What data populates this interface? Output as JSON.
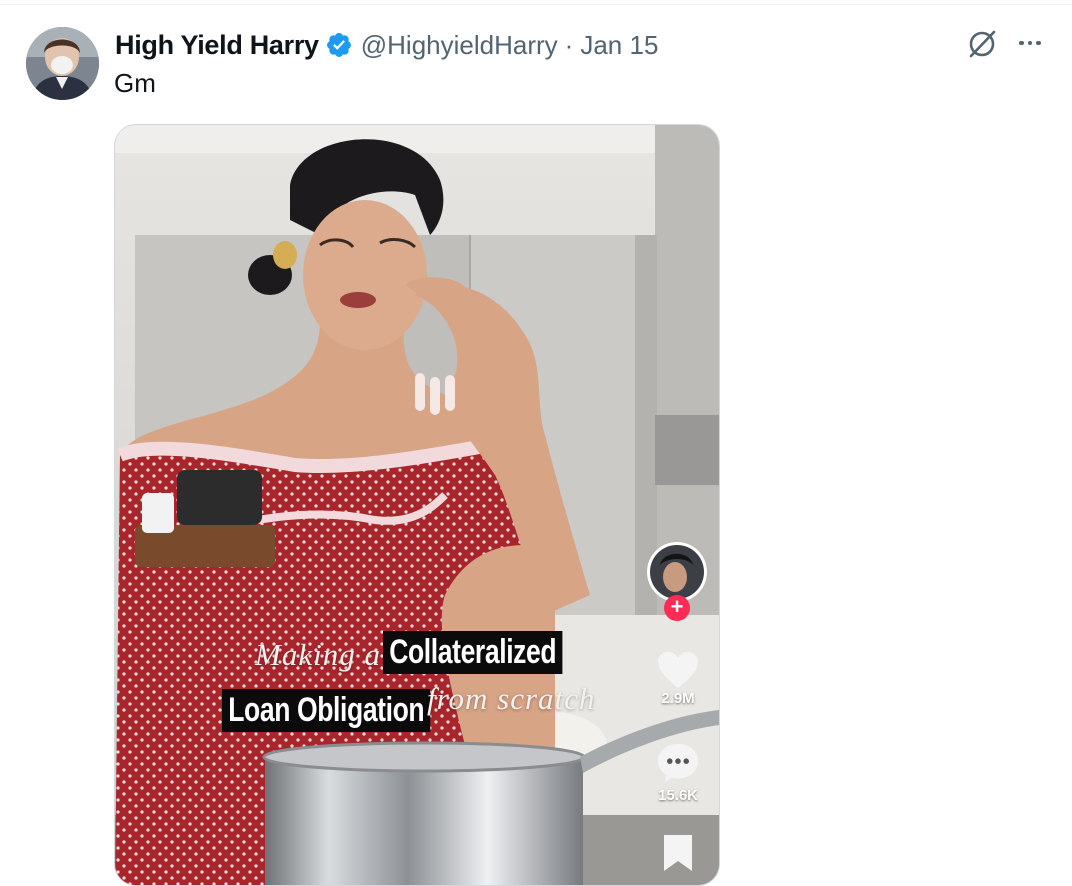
{
  "tweet": {
    "author_name": "High Yield Harry",
    "author_handle": "@HighyieldHarry",
    "separator": "·",
    "date": "Jan 15",
    "text": "Gm"
  },
  "video": {
    "caption_italic_1": "Making a",
    "caption_bold_1": "Collateralized",
    "caption_bold_2": "Loan Obligation",
    "caption_italic_2": "from scratch",
    "likes_count": "2.9M",
    "comments_count": "15.6K"
  },
  "colors": {
    "verified_badge": "#1d9bf0",
    "secondary_text": "#536471",
    "follow_plus": "#fe2c55"
  },
  "icons": [
    "verified-badge-icon",
    "grok-icon",
    "more-icon",
    "heart-icon",
    "comment-icon",
    "bookmark-icon",
    "follow-plus-icon"
  ]
}
